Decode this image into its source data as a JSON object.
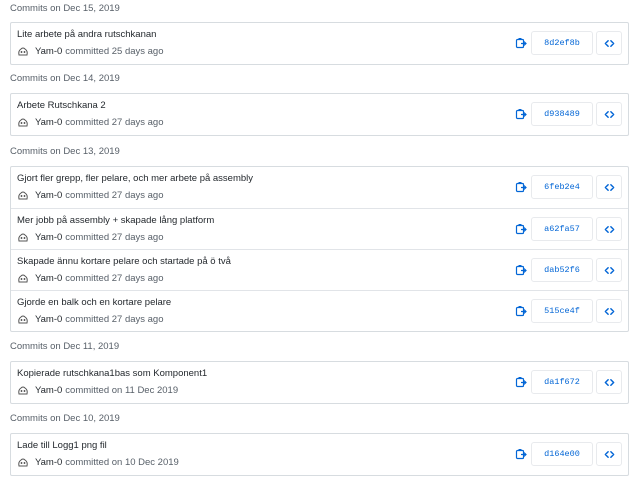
{
  "colors": {
    "link": "#0366d6",
    "muted": "#586069",
    "border": "#d7dce0"
  },
  "icons": {
    "copy": "clipboard-icon",
    "browse": "code-icon",
    "avatar": "identicon-avatar"
  },
  "groups": [
    {
      "header": "Commits on Dec 15, 2019",
      "commits": [
        {
          "message": "Lite arbete på andra rutschkanan",
          "author": "Yam-0",
          "when": "committed 25 days ago",
          "sha": "8d2ef8b"
        }
      ]
    },
    {
      "header": "Commits on Dec 14, 2019",
      "commits": [
        {
          "message": "Arbete Rutschkana 2",
          "author": "Yam-0",
          "when": "committed 27 days ago",
          "sha": "d938489"
        }
      ]
    },
    {
      "header": "Commits on Dec 13, 2019",
      "commits": [
        {
          "message": "Gjort fler grepp, fler pelare, och mer arbete på assembly",
          "author": "Yam-0",
          "when": "committed 27 days ago",
          "sha": "6feb2e4"
        },
        {
          "message": "Mer jobb på assembly + skapade lång platform",
          "author": "Yam-0",
          "when": "committed 27 days ago",
          "sha": "a62fa57"
        },
        {
          "message": "Skapade ännu kortare pelare och startade på ö två",
          "author": "Yam-0",
          "when": "committed 27 days ago",
          "sha": "dab52f6"
        },
        {
          "message": "Gjorde en balk och en kortare pelare",
          "author": "Yam-0",
          "when": "committed 27 days ago",
          "sha": "515ce4f"
        }
      ]
    },
    {
      "header": "Commits on Dec 11, 2019",
      "commits": [
        {
          "message": "Kopierade rutschkana1bas som Komponent1",
          "author": "Yam-0",
          "when": "committed on 11 Dec 2019",
          "sha": "da1f672"
        }
      ]
    },
    {
      "header": "Commits on Dec 10, 2019",
      "commits": [
        {
          "message": "Lade till Logg1 png fil",
          "author": "Yam-0",
          "when": "committed on 10 Dec 2019",
          "sha": "d164e00"
        }
      ]
    }
  ]
}
